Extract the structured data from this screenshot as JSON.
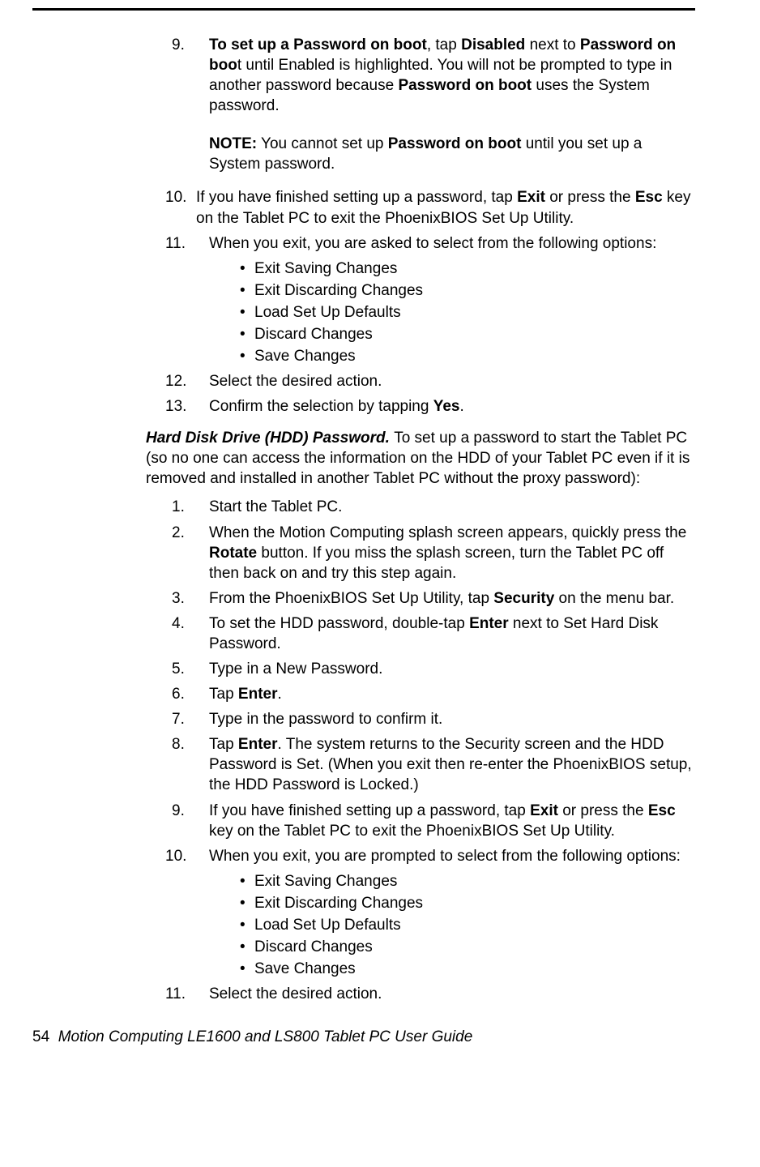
{
  "step9_a": "To set up a Password on boot",
  "step9_b": ", tap ",
  "step9_c": "Disabled",
  "step9_d": " next to ",
  "step9_e": "Password on boo",
  "step9_f": "t until Enabled is highlighted. You will not be prompted to type in another password because ",
  "step9_g": "Password on boot",
  "step9_h": " uses the System password.",
  "note_a": "NOTE:",
  "note_b": " You cannot set up ",
  "note_c": "Password on boot",
  "note_d": " until you set up a System password.",
  "step10_a": "If you have finished setting up a password, tap ",
  "step10_b": "Exit",
  "step10_c": " or press the ",
  "step10_d": "Esc",
  "step10_e": " key on the Tablet PC to exit the PhoenixBIOS Set Up Utility.",
  "step11": "When you exit, you are asked to select from the following options:",
  "opts": [
    "Exit Saving Changes",
    "Exit Discarding Changes",
    "Load Set Up Defaults",
    "Discard Changes",
    "Save Changes"
  ],
  "step12": "Select the desired action.",
  "step13_a": "Confirm the selection by tapping ",
  "step13_b": "Yes",
  "step13_c": ".",
  "hddTitle": "Hard Disk Drive (HDD) Password. ",
  "hddIntro": "To set up a password to start the Tablet PC (so no one can access the information on the HDD of your Tablet PC even if it is removed and installed in another Tablet PC without the proxy password):",
  "h1": "Start the Tablet PC.",
  "h2_a": "When the Motion Computing splash screen appears, quickly press the ",
  "h2_b": "Rotate",
  "h2_c": " button. If you miss the splash screen, turn the Tablet PC off then back on and try this step again.",
  "h3_a": "From the PhoenixBIOS Set Up Utility, tap ",
  "h3_b": "Security",
  "h3_c": " on the menu bar.",
  "h4_a": "To set the HDD password, double-tap ",
  "h4_b": "Enter",
  "h4_c": " next to Set Hard Disk Password.",
  "h5": "Type in a New Password.",
  "h6_a": "Tap ",
  "h6_b": "Enter",
  "h6_c": ".",
  "h7": "Type in the password to confirm it.",
  "h8_a": "Tap ",
  "h8_b": "Enter",
  "h8_c": ". The system returns to the Security screen and the HDD Password is Set. (When you exit then re-enter the PhoenixBIOS setup, the HDD Password is Locked.)",
  "h9_a": "If you have finished setting up a password, tap ",
  "h9_b": "Exit",
  "h9_c": " or press the ",
  "h9_d": "Esc",
  "h9_e": " key on the Tablet PC to exit the PhoenixBIOS Set Up Utility.",
  "h10": "When you exit, you are prompted to select from the following options:",
  "h11": "Select the desired action.",
  "footerPage": "54",
  "footerText": "Motion Computing LE1600 and LS800 Tablet PC User Guide",
  "nums": {
    "n9": "9.",
    "n10": "10.",
    "n11": "11.",
    "n12": "12.",
    "n13": "13.",
    "m1": "1.",
    "m2": "2.",
    "m3": "3.",
    "m4": "4.",
    "m5": "5.",
    "m6": "6.",
    "m7": "7.",
    "m8": "8.",
    "m9": "9.",
    "m10": "10.",
    "m11": "11."
  }
}
